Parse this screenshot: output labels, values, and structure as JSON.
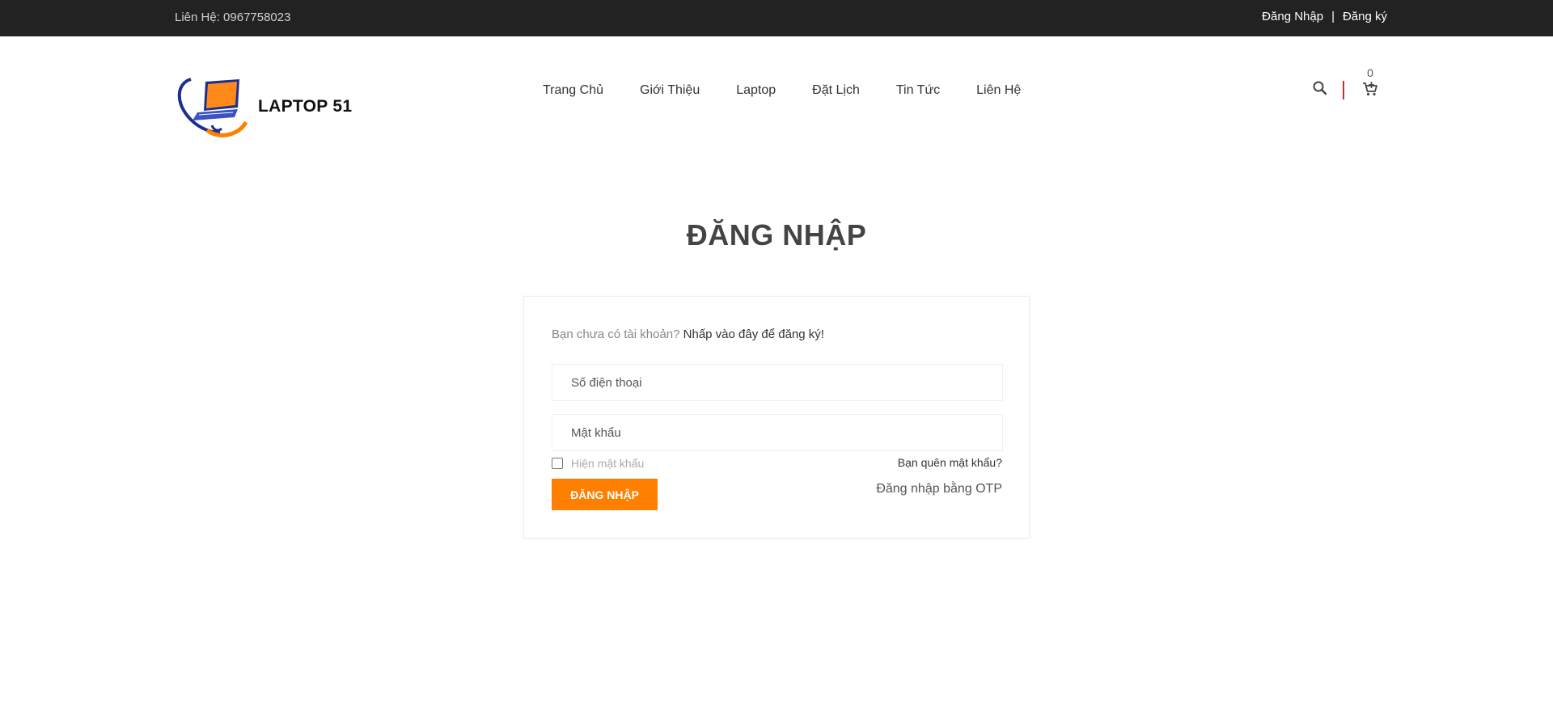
{
  "topbar": {
    "contact": "Liên Hệ: 0967758023",
    "login_link": "Đăng Nhập",
    "separator": "|",
    "register_link": "Đăng ký"
  },
  "header": {
    "logo_text": "LAPTOP 51",
    "nav": [
      "Trang Chủ",
      "Giới Thiệu",
      "Laptop",
      "Đặt Lịch",
      "Tin Tức",
      "Liên Hệ"
    ],
    "cart_count": "0",
    "search_icon": "search-icon",
    "cart_icon": "cart-icon"
  },
  "page": {
    "title": "ĐĂNG NHẬP"
  },
  "login_form": {
    "no_account_text": "Bạn chưa có tài khoản?",
    "register_link": "Nhấp vào đây để đăng ký!",
    "phone_placeholder": "Số điện thoại",
    "password_placeholder": "Mật khẩu",
    "show_password_label": "Hiện mật khẩu",
    "forgot_password": "Bạn quên mật khẩu?",
    "submit_label": "ĐĂNG NHẬP",
    "otp_link": "Đăng nhập bằng OTP"
  },
  "colors": {
    "topbar_bg": "#222222",
    "accent": "#ff7f00",
    "divider": "#bb3333"
  }
}
